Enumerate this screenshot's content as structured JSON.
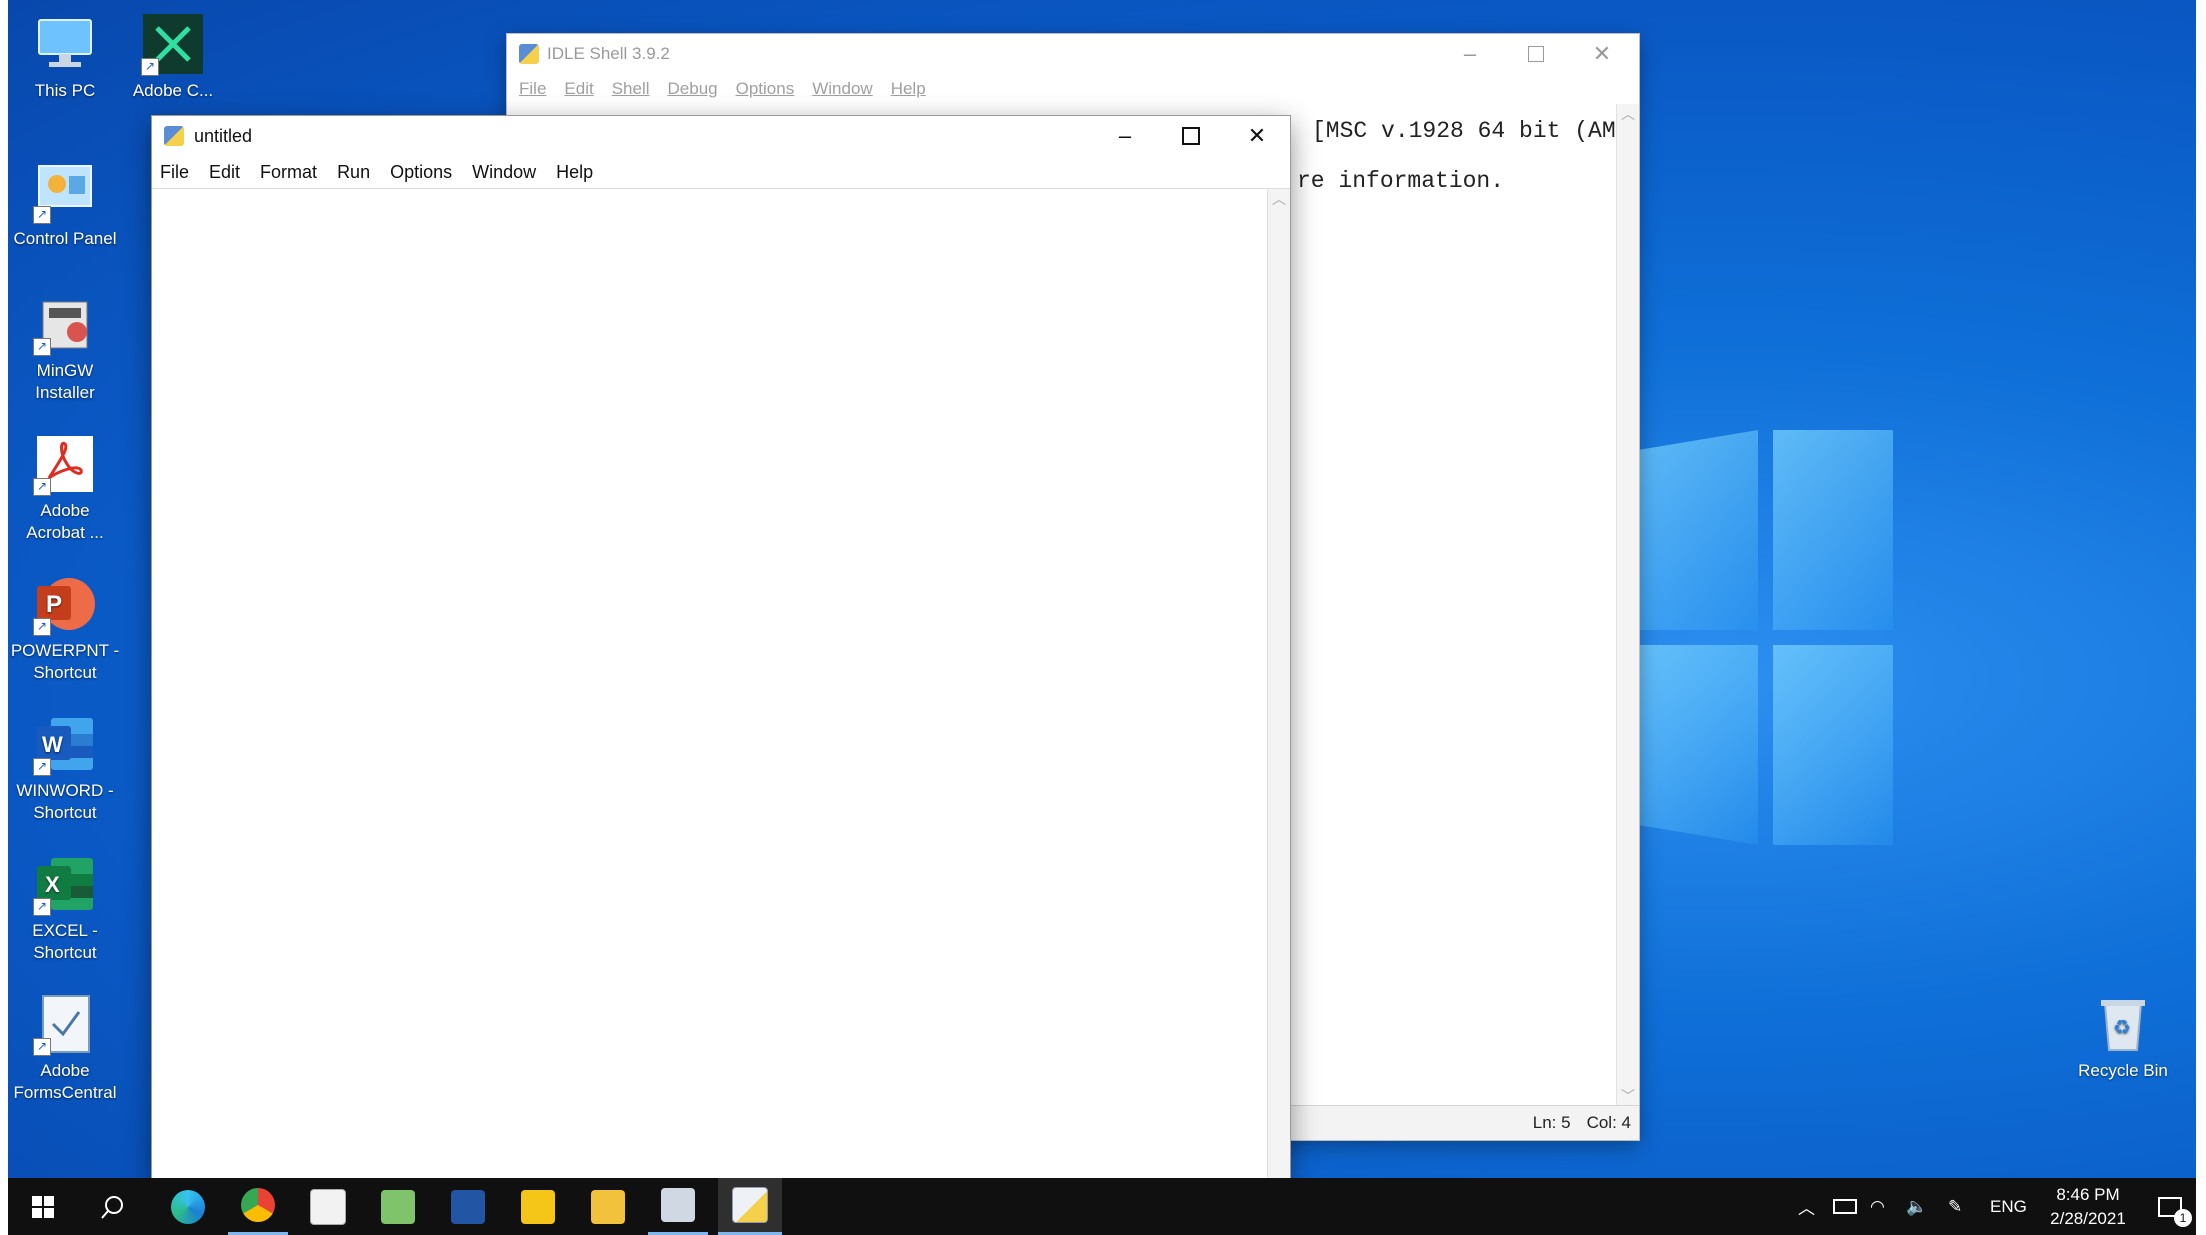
{
  "desktop": {
    "icons": [
      {
        "label": "This PC",
        "icon": "this-pc-icon"
      },
      {
        "label": "Adobe C...",
        "icon": "adobe-creative-cloud-icon"
      },
      {
        "label": "Control Panel",
        "icon": "control-panel-icon"
      },
      {
        "label": "MinGW Installer",
        "icon": "mingw-installer-icon"
      },
      {
        "label": "Adobe Acrobat ...",
        "icon": "adobe-acrobat-icon"
      },
      {
        "label": "POWERPNT - Shortcut",
        "icon": "powerpoint-icon"
      },
      {
        "label": "WINWORD - Shortcut",
        "icon": "word-icon"
      },
      {
        "label": "EXCEL - Shortcut",
        "icon": "excel-icon"
      },
      {
        "label": "Adobe FormsCentral",
        "icon": "forms-central-icon"
      },
      {
        "label": "Recycle Bin",
        "icon": "recycle-bin-icon"
      }
    ]
  },
  "shell_window": {
    "title": "IDLE Shell 3.9.2",
    "menu": [
      "File",
      "Edit",
      "Shell",
      "Debug",
      "Options",
      "Window",
      "Help"
    ],
    "line1_visible": "[MSC v.1928 64 bit (AM",
    "line2_visible": "re information.",
    "status_ln": "Ln: 5",
    "status_col": "Col: 4"
  },
  "editor_window": {
    "title": "untitled",
    "menu": [
      "File",
      "Edit",
      "Format",
      "Run",
      "Options",
      "Window",
      "Help"
    ]
  },
  "taskbar": {
    "lang": "ENG",
    "time": "8:46 PM",
    "date": "2/28/2021",
    "notification_count": "1"
  },
  "colors": {
    "desktop_blue": "#0a58c4",
    "taskbar": "#101010",
    "shell_menu_gray": "#a0a0a0"
  }
}
